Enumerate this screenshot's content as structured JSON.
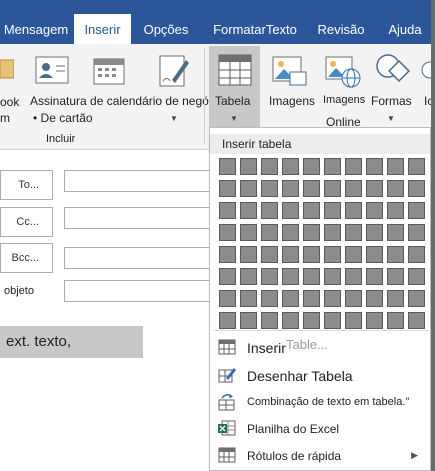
{
  "tabs": [
    {
      "label": "Mensagem",
      "active": false
    },
    {
      "label": "Inserir",
      "active": true
    },
    {
      "label": "Opções",
      "active": false
    },
    {
      "label": "FormatarTexto",
      "active": false
    },
    {
      "label": "Revisão",
      "active": false
    },
    {
      "label": "Ajuda",
      "active": false
    }
  ],
  "ribbon": {
    "attach_partial_top": "ook",
    "attach_partial_bottom": "m",
    "assinatura_line1": "Assinatura de calendário de negócios",
    "assinatura_line2": "• De cartão",
    "group_incluir": "Incluir",
    "tabela": "Tabela",
    "imagens": "Imagens",
    "imagens_online_line1": "Imagens",
    "imagens_online_line2": "Online",
    "formas": "Formas",
    "partial_right": "Ic"
  },
  "form": {
    "to_label": "To...",
    "cc_label": "Cc...",
    "bcc_label": "Bcc...",
    "subject_label": "objeto",
    "body_text": "ext. texto,"
  },
  "dropdown": {
    "header": "Inserir tabela",
    "grid_cols": 10,
    "grid_rows": 8,
    "items": [
      {
        "label": "Inserir",
        "icon": "table-icon"
      },
      {
        "label": "Desenhar Tabela",
        "icon": "draw-table-icon"
      },
      {
        "label": "Combinação de texto em tabela.\"",
        "icon": "convert-text-icon"
      },
      {
        "label": "Planilha do Excel",
        "icon": "excel-icon"
      },
      {
        "label": "Rótulos de rápida",
        "icon": "quick-tables-icon",
        "submenu": true
      }
    ],
    "ghost_text": "Table..."
  },
  "colors": {
    "brand_blue": "#2b579a",
    "ribbon_bg": "#f3f3f3",
    "selected_gray": "#c8c8c8",
    "grid_cell": "#8c8c8c",
    "excel_green": "#217346"
  }
}
